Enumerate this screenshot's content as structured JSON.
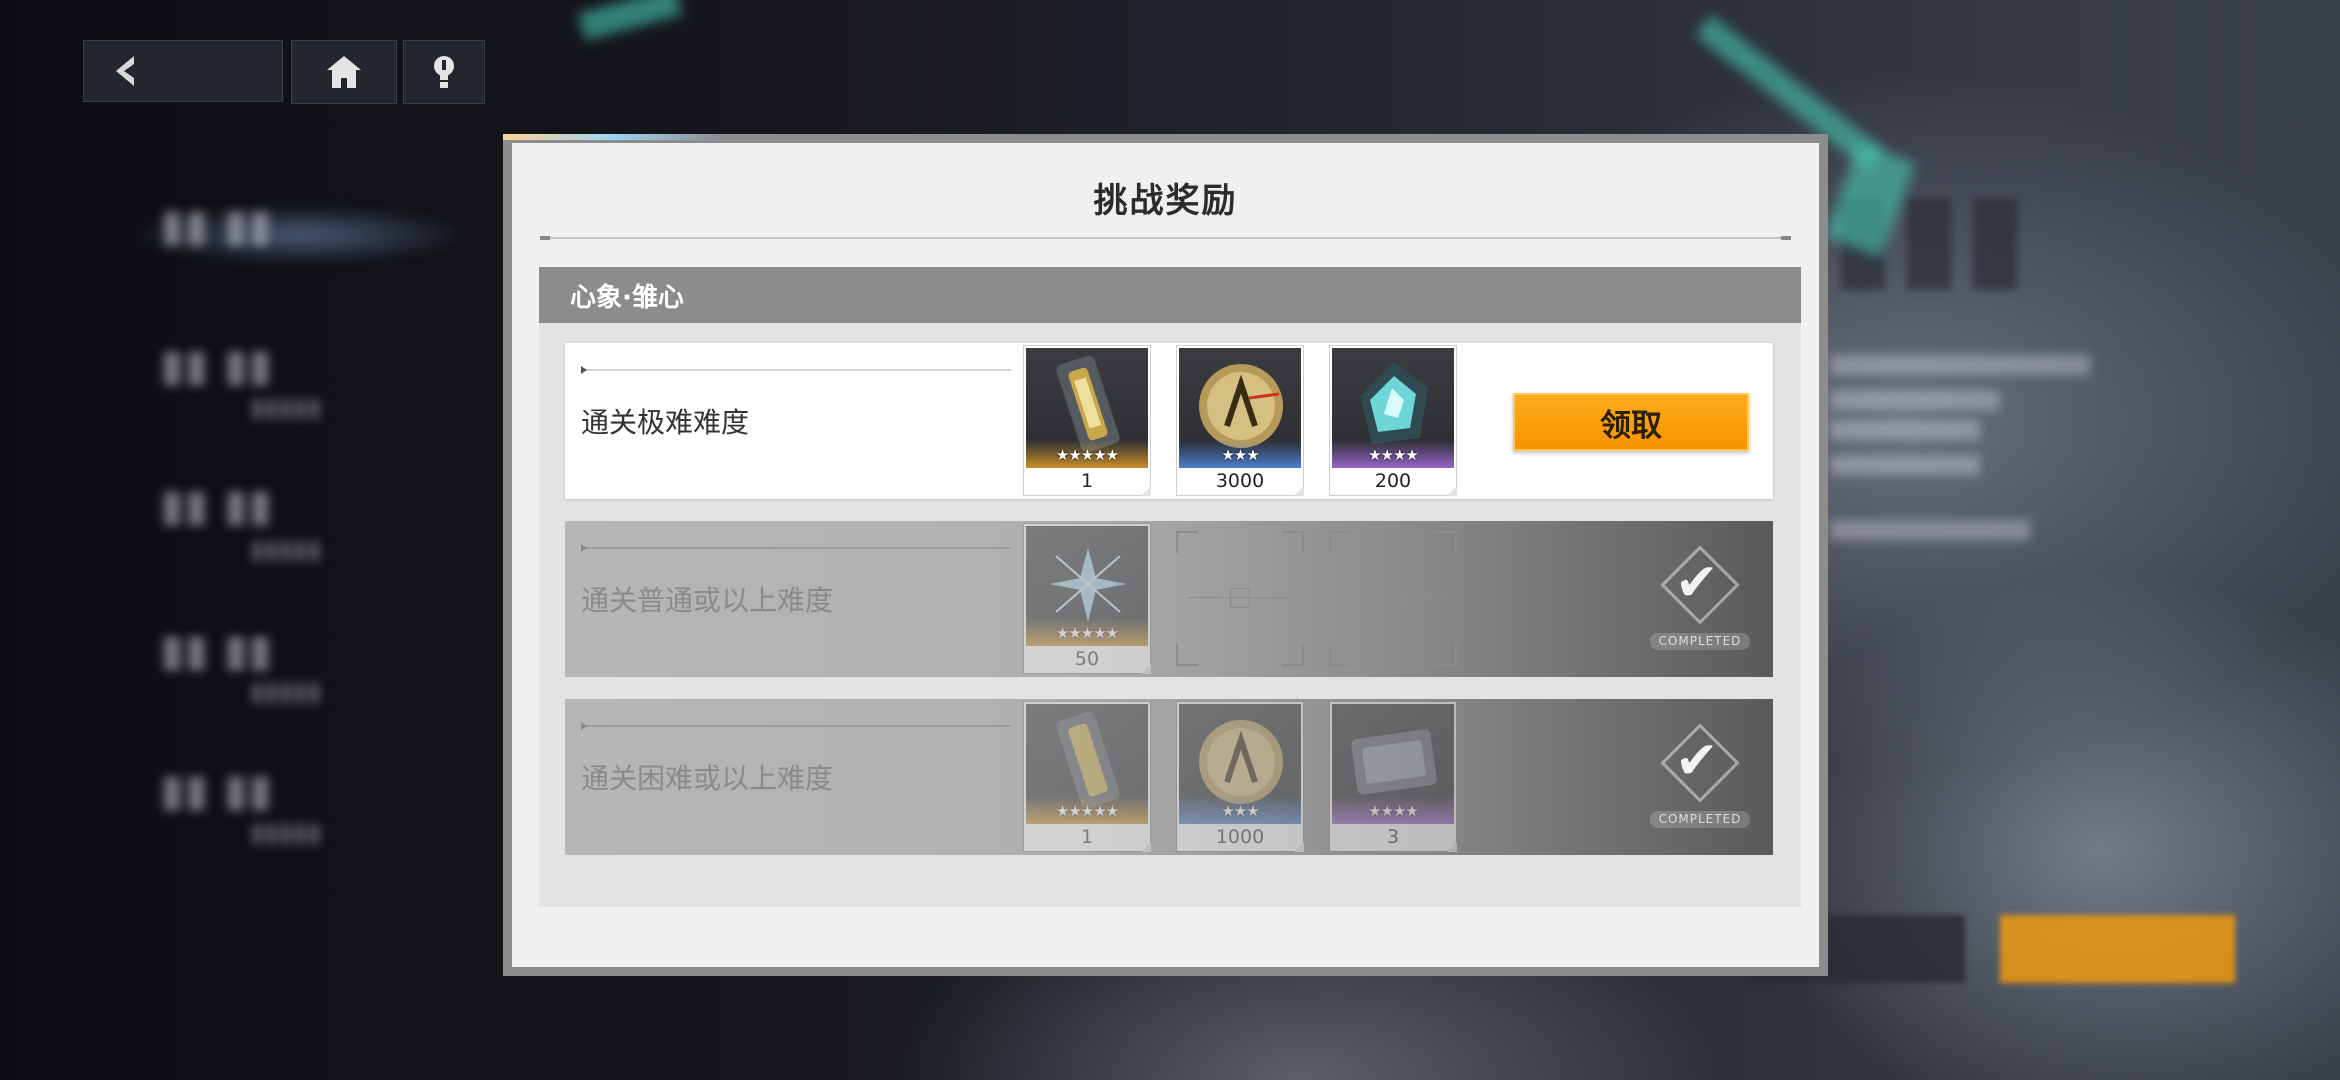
{
  "dialog": {
    "title": "挑战奖励"
  },
  "panel": {
    "header": "心象·雏心"
  },
  "rows": [
    {
      "label": "通关极难难度",
      "rewards": [
        {
          "stars": "★★★★★",
          "quantity": "1",
          "rarity": "gold"
        },
        {
          "stars": "★★★",
          "quantity": "3000",
          "rarity": "blue"
        },
        {
          "stars": "★★★★",
          "quantity": "200",
          "rarity": "purple"
        }
      ],
      "claim_label": "领取"
    },
    {
      "label": "通关普通或以上难度",
      "rewards": [
        {
          "stars": "★★★★★",
          "quantity": "50",
          "rarity": "gold"
        }
      ],
      "status": "COMPLETED"
    },
    {
      "label": "通关困难或以上难度",
      "rewards": [
        {
          "stars": "★★★★★",
          "quantity": "1",
          "rarity": "gold"
        },
        {
          "stars": "★★★",
          "quantity": "1000",
          "rarity": "blue"
        },
        {
          "stars": "★★★★",
          "quantity": "3",
          "rarity": "purple"
        }
      ],
      "status": "COMPLETED"
    }
  ],
  "icons": {
    "back": "back-arrow-icon",
    "home": "home-icon",
    "tip": "lightbulb-icon",
    "check": "check-icon"
  },
  "colors": {
    "claim": "#f69400",
    "panel_header": "#8c8c8c"
  }
}
